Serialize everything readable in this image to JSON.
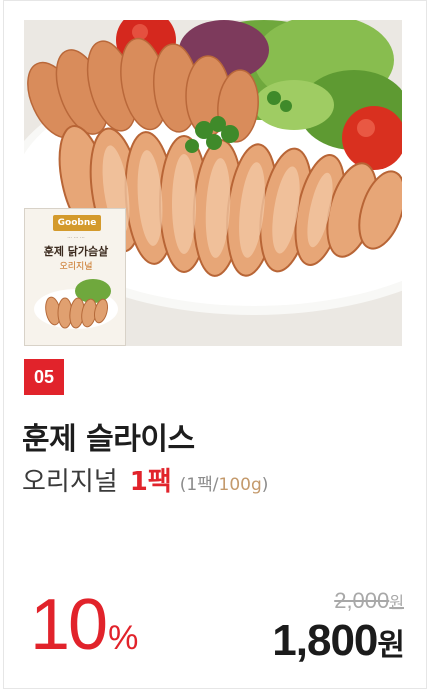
{
  "product": {
    "rank": "05",
    "name_line1": "훈제 슬라이스",
    "name_line2": "오리지널",
    "pack_count": "1팩",
    "pack_detail_open": "(1팩/",
    "pack_detail_unit": "100g",
    "pack_detail_close": ")"
  },
  "package": {
    "brand": "Goobne",
    "title": "훈제 닭가슴살",
    "subtitle": "오리지널"
  },
  "price": {
    "discount_value": "10",
    "discount_symbol": "%",
    "original_value": "2,000",
    "original_currency": "원",
    "sale_value": "1,800",
    "sale_currency": "원"
  },
  "colors": {
    "accent": "#e1232b",
    "text_dark": "#1d1d1d",
    "muted": "#a8a8a8",
    "unit_tan": "#c49a6c"
  }
}
